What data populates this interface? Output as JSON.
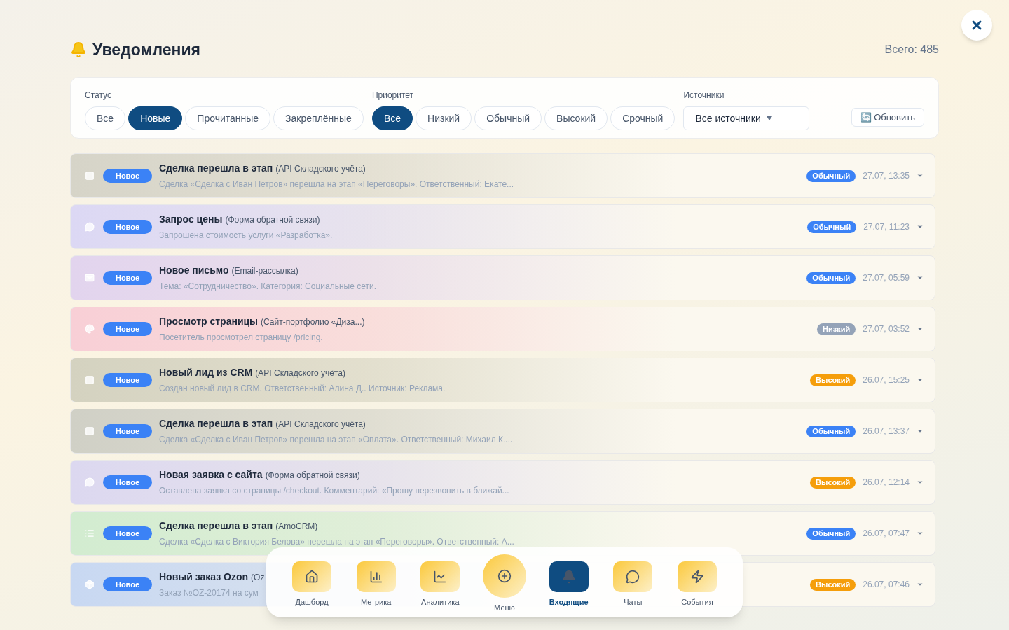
{
  "header": {
    "title": "Уведомления",
    "total": "Всего: 485"
  },
  "filters": {
    "status": {
      "label": "Статус",
      "options": [
        {
          "label": "Все",
          "selected": false
        },
        {
          "label": "Новые",
          "selected": true
        },
        {
          "label": "Прочитанные",
          "selected": false
        },
        {
          "label": "Закреплённые",
          "selected": false
        }
      ]
    },
    "priority": {
      "label": "Приоритет",
      "options": [
        {
          "label": "Все",
          "selected": true
        },
        {
          "label": "Низкий",
          "selected": false
        },
        {
          "label": "Обычный",
          "selected": false
        },
        {
          "label": "Высокий",
          "selected": false
        },
        {
          "label": "Срочный",
          "selected": false
        }
      ]
    },
    "sources": {
      "label": "Источники",
      "value": "Все источники"
    },
    "refresh": "🔄 Обновить"
  },
  "notifications": [
    {
      "kind": "square",
      "color": "#d6d4c8",
      "status": "Новое",
      "title": "Сделка перешла в этап",
      "source": "(API Складского учёта)",
      "text": "Сделка «Сделка с Иван Петров» перешла на этап «Переговоры». Ответственный: Екате...",
      "priority": {
        "label": "Обычный",
        "kind": "normal"
      },
      "time": "27.07, 13:35"
    },
    {
      "kind": "chat",
      "color": "#dcd8f4",
      "status": "Новое",
      "title": "Запрос цены",
      "source": "(Форма обратной связи)",
      "text": "Запрошена стоимость услуги «Разработка».",
      "priority": {
        "label": "Обычный",
        "kind": "normal"
      },
      "time": "27.07, 11:23"
    },
    {
      "kind": "mail",
      "color": "#e2d4ee",
      "status": "Новое",
      "title": "Новое письмо",
      "source": "(Email-рассылка)",
      "text": "Тема: «Сотрудничество». Категория: Социальные сети.",
      "priority": {
        "label": "Обычный",
        "kind": "normal"
      },
      "time": "27.07, 05:59"
    },
    {
      "kind": "palette",
      "color": "#f8cfd6",
      "status": "Новое",
      "title": "Просмотр страницы",
      "source": "(Сайт-портфолио «Диза...)",
      "text": "Посетитель просмотрел страницу /pricing.",
      "priority": {
        "label": "Низкий",
        "kind": "low"
      },
      "time": "27.07, 03:52"
    },
    {
      "kind": "square",
      "color": "#d4d2c0",
      "status": "Новое",
      "title": "Новый лид из CRM",
      "source": "(API Складского учёта)",
      "text": "Создан новый лид в CRM. Ответственный: Алина Д.. Источник: Реклама.",
      "priority": {
        "label": "Высокий",
        "kind": "high"
      },
      "time": "26.07, 15:25"
    },
    {
      "kind": "square",
      "color": "#d0d0c6",
      "status": "Новое",
      "title": "Сделка перешла в этап",
      "source": "(API Складского учёта)",
      "text": "Сделка «Сделка с Иван Петров» перешла на этап «Оплата». Ответственный: Михаил К....",
      "priority": {
        "label": "Обычный",
        "kind": "normal"
      },
      "time": "26.07, 13:37"
    },
    {
      "kind": "chat",
      "color": "#dcd8f0",
      "status": "Новое",
      "title": "Новая заявка с сайта",
      "source": "(Форма обратной связи)",
      "text": "Оставлена заявка со страницы /checkout. Комментарий: «Прошу перезвонить в ближай...",
      "priority": {
        "label": "Высокий",
        "kind": "high"
      },
      "time": "26.07, 12:14"
    },
    {
      "kind": "list",
      "color": "#d2ecd0",
      "status": "Новое",
      "title": "Сделка перешла в этап",
      "source": "(AmoCRM)",
      "text": "Сделка «Сделка с Виктория Белова» перешла на этап «Переговоры». Ответственный: А...",
      "priority": {
        "label": "Обычный",
        "kind": "normal"
      },
      "time": "26.07, 07:47"
    },
    {
      "kind": "box",
      "color": "#c8d8f2",
      "status": "Новое",
      "title": "Новый заказ Ozon",
      "source": "(Oz",
      "text": "Заказ №OZ-20174 на сум",
      "priority": {
        "label": "Высокий",
        "kind": "high"
      },
      "time": "26.07, 07:46"
    }
  ],
  "dock": [
    {
      "kind": "home",
      "label": "Дашборд",
      "selected": false
    },
    {
      "kind": "bars",
      "label": "Метрика",
      "selected": false
    },
    {
      "kind": "chart",
      "label": "Аналитика",
      "selected": false
    },
    {
      "kind": "plus",
      "label": "Меню",
      "selected": false
    },
    {
      "kind": "bell",
      "label": "Входящие",
      "selected": true
    },
    {
      "kind": "chat",
      "label": "Чаты",
      "selected": false
    },
    {
      "kind": "bolt",
      "label": "События",
      "selected": false
    }
  ]
}
